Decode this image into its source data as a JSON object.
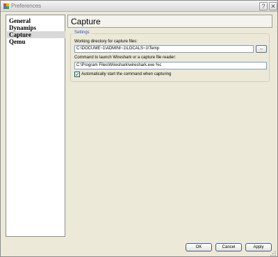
{
  "window": {
    "title": "Preferences",
    "help_glyph": "?",
    "close_glyph": "✕"
  },
  "sidebar": {
    "items": [
      {
        "label": "General",
        "selected": false
      },
      {
        "label": "Dynamips",
        "selected": false
      },
      {
        "label": "Capture",
        "selected": true
      },
      {
        "label": "Qemu",
        "selected": false
      }
    ]
  },
  "page": {
    "title": "Capture"
  },
  "settings": {
    "group_label": "Settings",
    "workdir_label": "Working directory for capture files:",
    "workdir_value": "C:\\DOCUME~1\\ADMINI~1\\LOCALS~1\\Temp",
    "browse_label": "...",
    "command_label": "Command to launch Wireshark or a capture file reader:",
    "command_value": "C:\\Program Files\\Wireshark\\wireshark.exe %c",
    "auto_start_label": "Automatically start the command when capturing",
    "auto_start_checked": true
  },
  "buttons": {
    "ok": "OK",
    "cancel": "Cancel",
    "apply": "Apply"
  },
  "colors": {
    "accent_blue": "#2a4fbf",
    "selection_gray": "#d8d8d8"
  }
}
